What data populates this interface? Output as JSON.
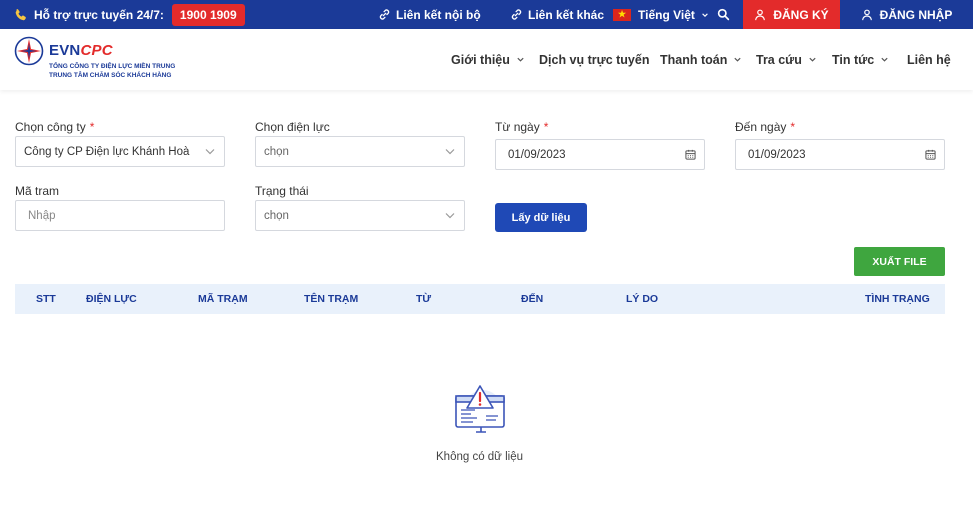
{
  "topbar": {
    "hotline_label": "Hỗ trợ trực tuyến 24/7:",
    "hotline_number": "1900 1909",
    "internal_link": "Liên kết nội bộ",
    "other_link": "Liên kết khác",
    "language": "Tiếng Việt",
    "register": "ĐĂNG KÝ",
    "login": "ĐĂNG NHẬP",
    "flag_star": "★"
  },
  "header": {
    "logo_evn": "EVN",
    "logo_cpc": "CPC",
    "logo_sub1": "TỔNG CÔNG TY ĐIỆN LỰC MIỀN TRUNG",
    "logo_sub2": "TRUNG TÂM CHĂM SÓC KHÁCH HÀNG",
    "nav": {
      "about": "Giới thiệu",
      "online_services": "Dịch vụ trực tuyến",
      "payment": "Thanh toán",
      "lookup": "Tra cứu",
      "news": "Tin tức",
      "contact": "Liên hệ"
    }
  },
  "form": {
    "company_label": "Chọn công ty",
    "company_value": "Công ty CP Điện lực Khánh Hoà",
    "power_label": "Chọn điện lực",
    "power_value": "chọn",
    "from_label": "Từ ngày",
    "from_value": "01/09/2023",
    "to_label": "Đến ngày",
    "to_value": "01/09/2023",
    "station_label": "Mã tram",
    "station_placeholder": "Nhập",
    "status_label": "Trạng thái",
    "status_value": "chọn",
    "required_mark": "*",
    "fetch_button": "Lấy dữ liệu",
    "export_button": "XUẤT FILE"
  },
  "table": {
    "headers": [
      "STT",
      "ĐIỆN LỰC",
      "MÃ TRẠM",
      "TÊN TRẠM",
      "TỪ",
      "ĐẾN",
      "LÝ DO",
      "TÌNH TRẠNG"
    ]
  },
  "empty": {
    "text": "Không có dữ liệu"
  },
  "colors": {
    "brand_blue": "#1b3a98",
    "accent_red": "#e32b2b",
    "export_green": "#3fa63f"
  }
}
